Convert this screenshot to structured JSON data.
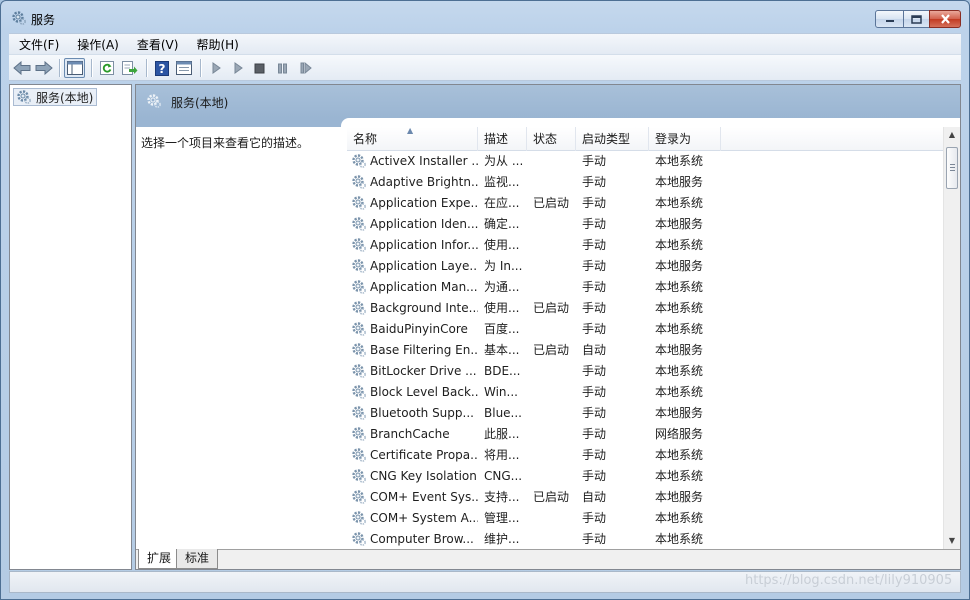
{
  "window": {
    "title": "服务"
  },
  "menu": [
    {
      "label": "文件(F)"
    },
    {
      "label": "操作(A)"
    },
    {
      "label": "查看(V)"
    },
    {
      "label": "帮助(H)"
    }
  ],
  "toolbar": {
    "icons": [
      "back-arrow-icon",
      "forward-arrow-icon",
      "show-hide-console-tree-icon",
      "refresh-icon",
      "export-list-icon",
      "help-icon",
      "properties-icon",
      "start-service-icon",
      "start-service-params-icon",
      "stop-service-icon",
      "pause-service-icon",
      "resume-service-icon"
    ]
  },
  "tree": {
    "root_label": "服务(本地)"
  },
  "detail": {
    "header_title": "服务(本地)",
    "description_hint": "选择一个项目来查看它的描述。",
    "columns": {
      "name": "名称",
      "desc": "描述",
      "state": "状态",
      "startup": "启动类型",
      "logon": "登录为"
    },
    "rows": [
      {
        "name": "ActiveX Installer ...",
        "desc": "为从 ...",
        "state": "",
        "startup": "手动",
        "logon": "本地系统"
      },
      {
        "name": "Adaptive Brightn...",
        "desc": "监视...",
        "state": "",
        "startup": "手动",
        "logon": "本地服务"
      },
      {
        "name": "Application Expe...",
        "desc": "在应...",
        "state": "已启动",
        "startup": "手动",
        "logon": "本地系统"
      },
      {
        "name": "Application Iden...",
        "desc": "确定...",
        "state": "",
        "startup": "手动",
        "logon": "本地服务"
      },
      {
        "name": "Application Infor...",
        "desc": "使用...",
        "state": "",
        "startup": "手动",
        "logon": "本地系统"
      },
      {
        "name": "Application Laye...",
        "desc": "为 In...",
        "state": "",
        "startup": "手动",
        "logon": "本地服务"
      },
      {
        "name": "Application Man...",
        "desc": "为通...",
        "state": "",
        "startup": "手动",
        "logon": "本地系统"
      },
      {
        "name": "Background Inte...",
        "desc": "使用...",
        "state": "已启动",
        "startup": "手动",
        "logon": "本地系统"
      },
      {
        "name": "BaiduPinyinCore",
        "desc": "百度...",
        "state": "",
        "startup": "手动",
        "logon": "本地系统"
      },
      {
        "name": "Base Filtering En...",
        "desc": "基本...",
        "state": "已启动",
        "startup": "自动",
        "logon": "本地服务"
      },
      {
        "name": "BitLocker Drive ...",
        "desc": "BDE...",
        "state": "",
        "startup": "手动",
        "logon": "本地系统"
      },
      {
        "name": "Block Level Back...",
        "desc": "Win...",
        "state": "",
        "startup": "手动",
        "logon": "本地系统"
      },
      {
        "name": "Bluetooth Supp...",
        "desc": "Blue...",
        "state": "",
        "startup": "手动",
        "logon": "本地服务"
      },
      {
        "name": "BranchCache",
        "desc": "此服...",
        "state": "",
        "startup": "手动",
        "logon": "网络服务"
      },
      {
        "name": "Certificate Propa...",
        "desc": "将用...",
        "state": "",
        "startup": "手动",
        "logon": "本地系统"
      },
      {
        "name": "CNG Key Isolation",
        "desc": "CNG...",
        "state": "",
        "startup": "手动",
        "logon": "本地系统"
      },
      {
        "name": "COM+ Event Sys...",
        "desc": "支持...",
        "state": "已启动",
        "startup": "自动",
        "logon": "本地服务"
      },
      {
        "name": "COM+ System A...",
        "desc": "管理...",
        "state": "",
        "startup": "手动",
        "logon": "本地系统"
      },
      {
        "name": "Computer Brow...",
        "desc": "维护...",
        "state": "",
        "startup": "手动",
        "logon": "本地系统"
      }
    ]
  },
  "tabs": [
    {
      "label": "扩展"
    },
    {
      "label": "标准"
    }
  ],
  "watermark": "https://blog.csdn.net/lily910905"
}
